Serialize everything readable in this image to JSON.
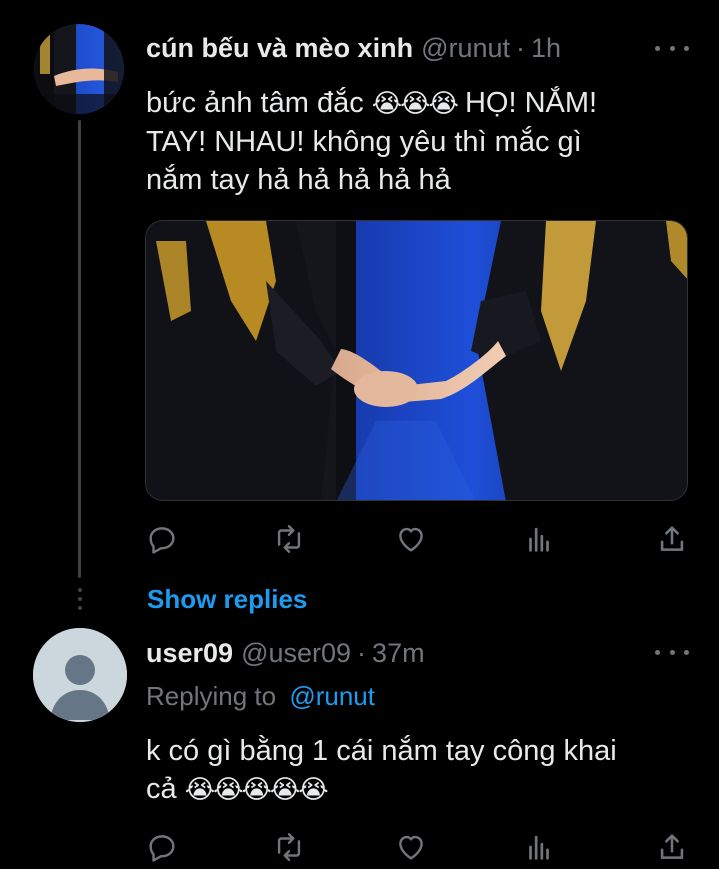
{
  "tweet1": {
    "display_name": "cún bếu và mèo xinh",
    "handle": "@runut",
    "separator": "·",
    "time": "1h",
    "text_line1": "bức ảnh tâm đắc",
    "text_line1_emoji": "😭😭😭",
    "text_line1_end": "HỌ! NẮM!",
    "text_line2": "TAY! NHAU! không yêu thì mắc gì",
    "text_line3": "nắm tay hả hả hả hả hả",
    "avatar_icon": "avatar-photo",
    "media_icon": "photo-holding-hands"
  },
  "thread": {
    "show_replies_label": "Show replies"
  },
  "tweet2": {
    "display_name": "user09",
    "handle": "@user09",
    "separator": "·",
    "time": "37m",
    "replying_label": "Replying to",
    "replying_handle": "@runut",
    "text_line1": "k có gì bằng 1 cái nắm tay công khai",
    "text_line2": "cả",
    "text_line2_emoji": "😭😭😭😭😭",
    "avatar_icon": "default-avatar"
  },
  "actions": [
    "reply-icon",
    "retweet-icon",
    "like-icon",
    "analytics-icon",
    "share-icon"
  ],
  "colors": {
    "background": "#000000",
    "primary_text": "#e7e9ea",
    "secondary_text": "#71767b",
    "link": "#1d9bf0"
  }
}
